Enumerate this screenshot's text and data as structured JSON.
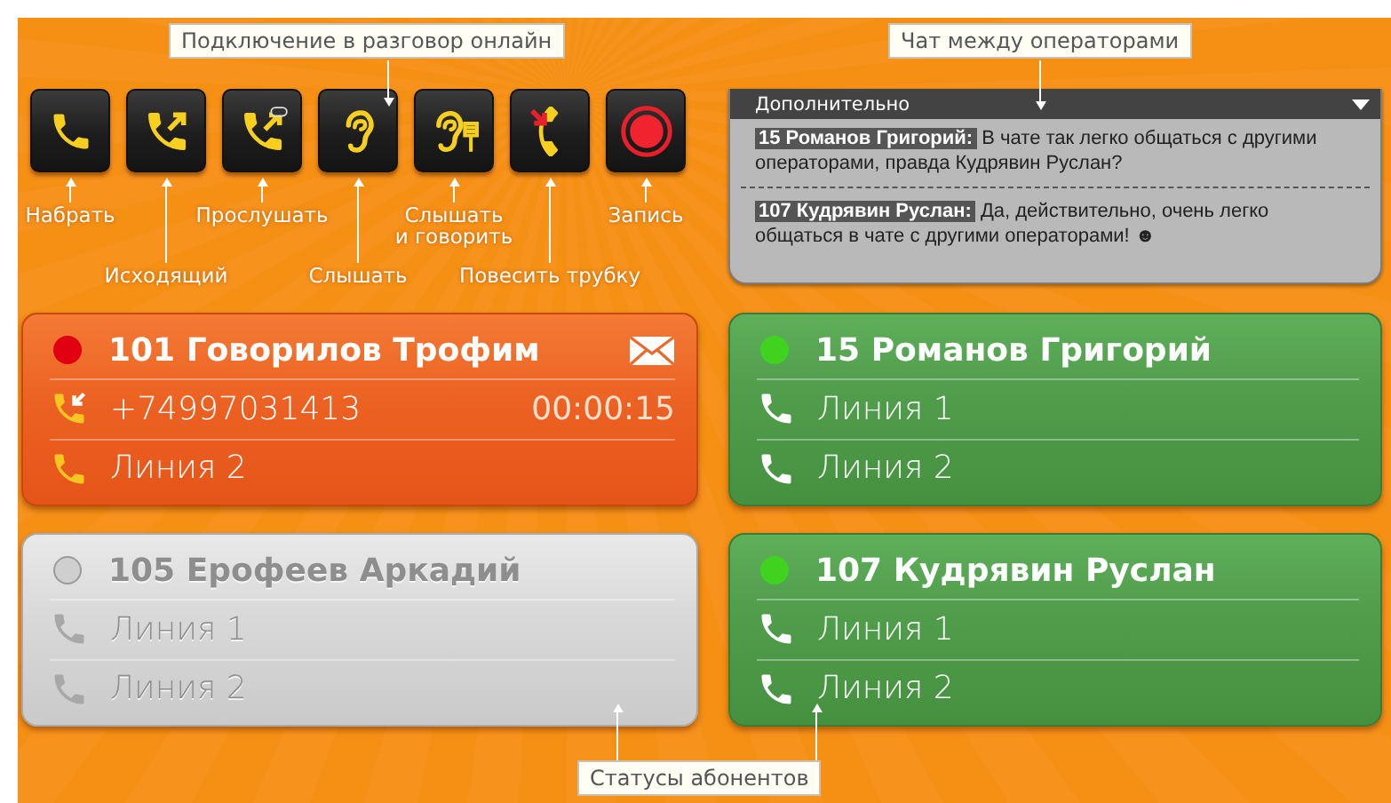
{
  "toolbar": {
    "buttons": [
      {
        "kind": "dial",
        "label": "Набрать",
        "long_arrow": false
      },
      {
        "kind": "outgoing",
        "label": "Исходящий",
        "long_arrow": true
      },
      {
        "kind": "listen",
        "label": "Прослушать",
        "long_arrow": false
      },
      {
        "kind": "hear",
        "label": "Слышать",
        "long_arrow": true
      },
      {
        "kind": "hear_talk",
        "label": "Слышать\nи говорить",
        "long_arrow": false
      },
      {
        "kind": "hangup",
        "label": "Повесить трубку",
        "long_arrow": true
      },
      {
        "kind": "record",
        "label": "Запись",
        "long_arrow": false
      }
    ]
  },
  "chat": {
    "title": "Дополнительно",
    "messages": [
      {
        "author": "15 Романов Григорий:",
        "text": "В чате так легко общаться с другими операторами, правда Кудрявин Руслан?"
      },
      {
        "author": "107 Кудрявин Руслан:",
        "text": "Да, действительно, очень легко общаться в чате с другими операторами! ☻"
      }
    ]
  },
  "subscribers": [
    {
      "kind": "busy",
      "color": "#e00012",
      "name": "101 Говорилов Трофим",
      "message": true,
      "lines": [
        {
          "kind": "incoming",
          "text": "+74997031413",
          "time": "00:00:15"
        },
        {
          "kind": "line",
          "text": "Линия 2"
        }
      ]
    },
    {
      "kind": "online",
      "color": "#3fd21f",
      "name": "15 Романов Григорий",
      "message": false,
      "lines": [
        {
          "kind": "line",
          "text": "Линия 1"
        },
        {
          "kind": "line",
          "text": "Линия 2"
        }
      ]
    },
    {
      "kind": "offline",
      "color": "#cfcfcf",
      "name": "105 Ерофеев Аркадий",
      "message": false,
      "lines": [
        {
          "kind": "line",
          "text": "Линия 1"
        },
        {
          "kind": "line",
          "text": "Линия 2"
        }
      ]
    },
    {
      "kind": "online",
      "color": "#3fd21f",
      "name": "107 Кудрявин Руслан",
      "message": false,
      "lines": [
        {
          "kind": "line",
          "text": "Линия 1"
        },
        {
          "kind": "line",
          "text": "Линия 2"
        }
      ]
    }
  ],
  "annotations": [
    {
      "kind": "connect",
      "text": "Подключение в разговор онлайн"
    },
    {
      "kind": "chat",
      "text": "Чат между операторами"
    },
    {
      "kind": "statuses",
      "text": "Статусы абонентов"
    }
  ]
}
